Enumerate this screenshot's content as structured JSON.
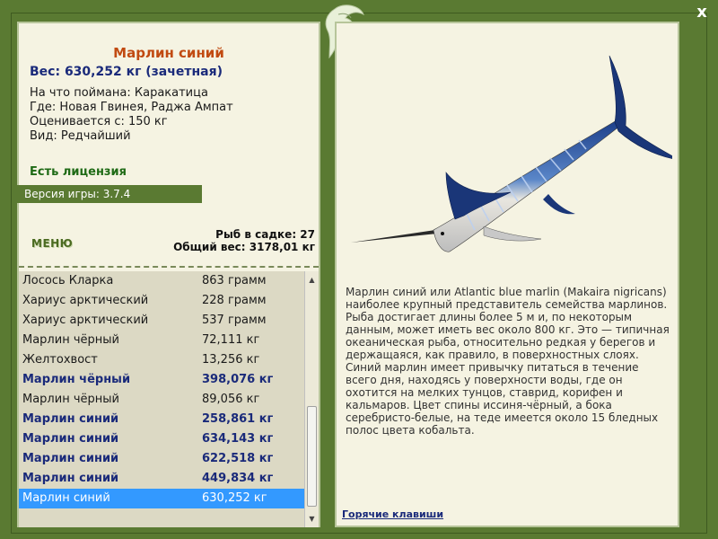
{
  "close_label": "x",
  "details": {
    "title": "Марлин синий",
    "weight": "Вес: 630,252 кг (зачетная)",
    "caught_with": "На что поймана: Каракатица",
    "location": "Где: Новая Гвинея, Раджа Ампат",
    "valued_from": "Оценивается с: 150 кг",
    "rarity": "Вид: Редчайший"
  },
  "license": "Есть лицензия",
  "version": "Версия игры: 3.7.4",
  "menu_label": "МЕНЮ",
  "stats": {
    "fish_in_net": "Рыб в садке: 27",
    "total_weight": "Общий вес: 3178,01 кг"
  },
  "catch_list": [
    {
      "name": "Лосось Кларка",
      "weight": "863 грамм",
      "bold": false,
      "selected": false
    },
    {
      "name": "Хариус арктический",
      "weight": "228 грамм",
      "bold": false,
      "selected": false
    },
    {
      "name": "Хариус арктический",
      "weight": "537 грамм",
      "bold": false,
      "selected": false
    },
    {
      "name": "Марлин чёрный",
      "weight": "72,111 кг",
      "bold": false,
      "selected": false
    },
    {
      "name": "Желтохвост",
      "weight": "13,256 кг",
      "bold": false,
      "selected": false
    },
    {
      "name": "Марлин чёрный",
      "weight": "398,076 кг",
      "bold": true,
      "selected": false
    },
    {
      "name": "Марлин чёрный",
      "weight": "89,056 кг",
      "bold": false,
      "selected": false
    },
    {
      "name": "Марлин синий",
      "weight": "258,861 кг",
      "bold": true,
      "selected": false
    },
    {
      "name": "Марлин синий",
      "weight": "634,143 кг",
      "bold": true,
      "selected": false
    },
    {
      "name": "Марлин синий",
      "weight": "622,518 кг",
      "bold": true,
      "selected": false
    },
    {
      "name": "Марлин синий",
      "weight": "449,834 кг",
      "bold": true,
      "selected": false
    },
    {
      "name": "Марлин синий",
      "weight": "630,252 кг",
      "bold": false,
      "selected": true
    }
  ],
  "description": "Марлин синий или Atlantic blue marlin (Makaira nigricans) наиболее крупный представитель семейства марлинов. Рыба достигает длины более 5 м и, по некоторым данным, может иметь вес около 800 кг. Это — типичная океаническая рыба, относительно редкая у берегов и держащаяся, как правило, в поверхностных слоях. Синий марлин имеет привычку питаться в течение всего дня, находясь у поверхности воды, где он охотится на мелких тунцов, ставрид, корифен и кальмаров. Цвет спины иссиня-чёрный, а бока серебристо-белые, на теде имеется около 15 бледных полос цвета кобальта.",
  "hotkeys_label": "Горячие клавиши"
}
